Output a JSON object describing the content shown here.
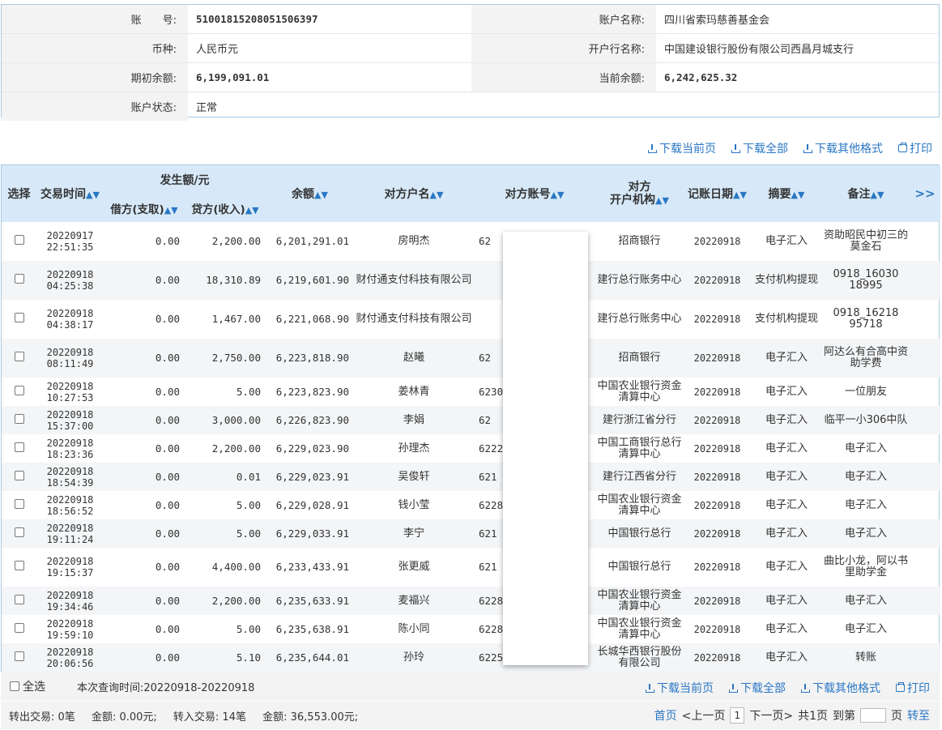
{
  "account": {
    "number_label": "账　　号:",
    "number": "51001815208051506397",
    "name_label": "账户名称:",
    "name": "四川省索玛慈善基金会",
    "currency_label": "币种:",
    "currency": "人民币元",
    "bank_label": "开户行名称:",
    "bank": "中国建设银行股份有限公司西昌月城支行",
    "opening_label": "期初余额:",
    "opening": "6,199,091.01",
    "current_label": "当前余额:",
    "current": "6,242,625.32",
    "status_label": "账户状态:",
    "status": "正常"
  },
  "toolbar": {
    "download_page": "下载当前页",
    "download_all": "下载全部",
    "download_other": "下载其他格式",
    "print": "打印"
  },
  "table": {
    "headers": {
      "select": "选择",
      "time": "交易时间",
      "amount_group": "发生额/元",
      "debit": "借方(支取)",
      "credit": "贷方(收入)",
      "balance": "余额",
      "counterparty_name": "对方户名",
      "counterparty_account": "对方账号",
      "counterparty_bank": "对方\n开户机构",
      "booking_date": "记账日期",
      "summary": "摘要",
      "remark": "备注",
      "expand": ">>"
    },
    "rows": [
      {
        "date": "20220917",
        "time": "22:51:35",
        "debit": "0.00",
        "credit": "2,200.00",
        "balance": "6,201,291.01",
        "name": "房明杰",
        "acct": "62",
        "bank": "招商银行",
        "book": "20220918",
        "summary": "电子汇入",
        "remark": "资助昭民中初三的莫金石",
        "tall": true
      },
      {
        "date": "20220918",
        "time": "04:25:38",
        "debit": "0.00",
        "credit": "18,310.89",
        "balance": "6,219,601.90",
        "name": "财付通支付科技有限公司",
        "acct": "",
        "bank": "建行总行账务中心",
        "book": "20220918",
        "summary": "支付机构提现",
        "remark": "0918_16030 18995",
        "tall": true
      },
      {
        "date": "20220918",
        "time": "04:38:17",
        "debit": "0.00",
        "credit": "1,467.00",
        "balance": "6,221,068.90",
        "name": "财付通支付科技有限公司",
        "acct": "",
        "bank": "建行总行账务中心",
        "book": "20220918",
        "summary": "支付机构提现",
        "remark": "0918_16218 95718",
        "tall": true
      },
      {
        "date": "20220918",
        "time": "08:11:49",
        "debit": "0.00",
        "credit": "2,750.00",
        "balance": "6,223,818.90",
        "name": "赵曦",
        "acct": "62",
        "bank": "招商银行",
        "book": "20220918",
        "summary": "电子汇入",
        "remark": "阿达么有合高中资助学费",
        "tall": true
      },
      {
        "date": "20220918",
        "time": "10:27:53",
        "debit": "0.00",
        "credit": "5.00",
        "balance": "6,223,823.90",
        "name": "姜林青",
        "acct": "6230",
        "bank": "中国农业银行资金清算中心",
        "book": "20220918",
        "summary": "电子汇入",
        "remark": "一位朋友"
      },
      {
        "date": "20220918",
        "time": "15:37:00",
        "debit": "0.00",
        "credit": "3,000.00",
        "balance": "6,226,823.90",
        "name": "李娟",
        "acct": "62",
        "bank": "建行浙江省分行",
        "book": "20220918",
        "summary": "电子汇入",
        "remark": "临平一小306中队"
      },
      {
        "date": "20220918",
        "time": "18:23:36",
        "debit": "0.00",
        "credit": "2,200.00",
        "balance": "6,229,023.90",
        "name": "孙理杰",
        "acct": "6222",
        "bank": "中国工商银行总行清算中心",
        "book": "20220918",
        "summary": "电子汇入",
        "remark": "电子汇入"
      },
      {
        "date": "20220918",
        "time": "18:54:39",
        "debit": "0.00",
        "credit": "0.01",
        "balance": "6,229,023.91",
        "name": "吴俊轩",
        "acct": "621",
        "bank": "建行江西省分行",
        "book": "20220918",
        "summary": "电子汇入",
        "remark": "电子汇入"
      },
      {
        "date": "20220918",
        "time": "18:56:52",
        "debit": "0.00",
        "credit": "5.00",
        "balance": "6,229,028.91",
        "name": "钱小莹",
        "acct": "6228",
        "bank": "中国农业银行资金清算中心",
        "book": "20220918",
        "summary": "电子汇入",
        "remark": "电子汇入"
      },
      {
        "date": "20220918",
        "time": "19:11:24",
        "debit": "0.00",
        "credit": "5.00",
        "balance": "6,229,033.91",
        "name": "李宁",
        "acct": "621",
        "bank": "中国银行总行",
        "book": "20220918",
        "summary": "电子汇入",
        "remark": "电子汇入"
      },
      {
        "date": "20220918",
        "time": "19:15:37",
        "debit": "0.00",
        "credit": "4,400.00",
        "balance": "6,233,433.91",
        "name": "张更威",
        "acct": "621",
        "bank": "中国银行总行",
        "book": "20220918",
        "summary": "电子汇入",
        "remark": "曲比小龙，阿以书里助学金",
        "tall": true
      },
      {
        "date": "20220918",
        "time": "19:34:46",
        "debit": "0.00",
        "credit": "2,200.00",
        "balance": "6,235,633.91",
        "name": "麦福兴",
        "acct": "6228",
        "bank": "中国农业银行资金清算中心",
        "book": "20220918",
        "summary": "电子汇入",
        "remark": "电子汇入"
      },
      {
        "date": "20220918",
        "time": "19:59:10",
        "debit": "0.00",
        "credit": "5.00",
        "balance": "6,235,638.91",
        "name": "陈小同",
        "acct": "6228",
        "bank": "中国农业银行资金清算中心",
        "book": "20220918",
        "summary": "电子汇入",
        "remark": "电子汇入"
      },
      {
        "date": "20220918",
        "time": "20:06:56",
        "debit": "0.00",
        "credit": "5.10",
        "balance": "6,235,644.01",
        "name": "孙玲",
        "acct": "6225",
        "bank": "长城华西银行股份有限公司",
        "book": "20220918",
        "summary": "电子汇入",
        "remark": "转账"
      }
    ]
  },
  "footer": {
    "select_all": "全选",
    "query_time": "本次查询时间:20220918-20220918",
    "out_tx": "转出交易: 0笔",
    "out_amount": "金额: 0.00元;",
    "in_tx": "转入交易: 14笔",
    "in_amount": "金额: 36,553.00元;",
    "first": "首页",
    "prev": "<上一页",
    "page": "1",
    "next": "下一页>",
    "total": "共1页",
    "goto": "到第",
    "page_unit": "页",
    "go": "转至"
  }
}
